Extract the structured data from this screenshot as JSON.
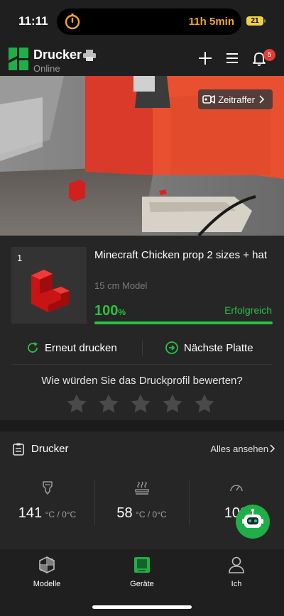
{
  "status_bar": {
    "time": "11:11",
    "live_activity_text": "11h 5min",
    "battery": "21"
  },
  "header": {
    "title": "Drucker",
    "subtitle": "Online",
    "notification_count": "5"
  },
  "camera": {
    "timelapse_label": "Zeitraffer"
  },
  "print_job": {
    "plate_number": "1",
    "title": "Minecraft Chicken prop 2 sizes + hat",
    "subtitle": "15 cm Model",
    "progress_value": "100",
    "progress_unit": "%",
    "progress_fraction": 1.0,
    "status": "Erfolgreich",
    "reprint_label": "Erneut drucken",
    "next_plate_label": "Nächste Platte",
    "rating_question": "Wie würden Sie das Druckprofil bewerten?",
    "rating_stars_filled": 0,
    "rating_stars_total": 5
  },
  "printer_section": {
    "title": "Drucker",
    "see_all_label": "Alles ansehen",
    "temps": [
      {
        "icon": "nozzle-icon",
        "value": "141",
        "unit": "°C / 0°C"
      },
      {
        "icon": "heatbed-icon",
        "value": "58",
        "unit": "°C / 0°C"
      },
      {
        "icon": "speed-icon",
        "value": "100",
        "unit": ""
      }
    ]
  },
  "nav": {
    "items": [
      {
        "label": "Modelle",
        "icon": "models-icon"
      },
      {
        "label": "Geräte",
        "icon": "devices-icon"
      },
      {
        "label": "Ich",
        "icon": "profile-icon"
      }
    ],
    "active_index": 1
  },
  "colors": {
    "accent_green": "#29c141",
    "background": "#1f1f1f",
    "card": "#262626"
  }
}
